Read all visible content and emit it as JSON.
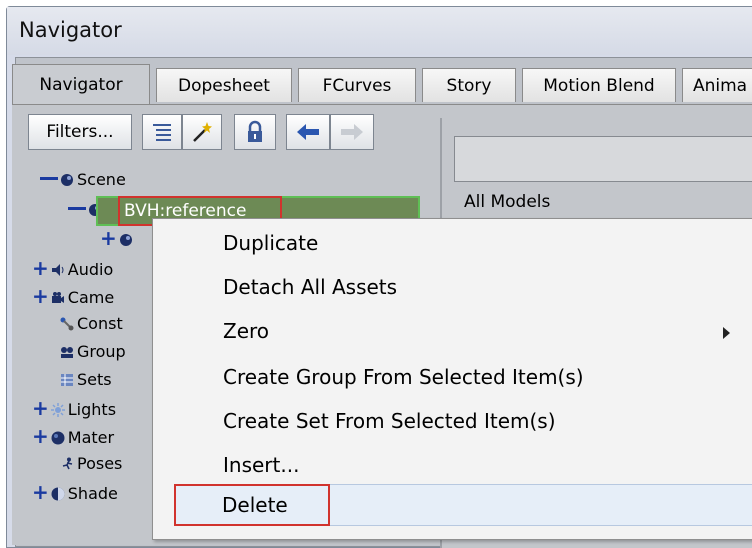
{
  "window": {
    "title": "Navigator"
  },
  "tabs": [
    {
      "label": "Navigator"
    },
    {
      "label": "Dopesheet"
    },
    {
      "label": "FCurves"
    },
    {
      "label": "Story"
    },
    {
      "label": "Motion Blend"
    },
    {
      "label": "Anima"
    }
  ],
  "toolbar": {
    "filters_label": "Filters...",
    "icons": [
      "list-icon",
      "magic-wand-icon",
      "lock-icon",
      "arrow-left-icon",
      "arrow-right-icon"
    ]
  },
  "tree": {
    "items": [
      {
        "label": "Scene",
        "icon": "scene-icon"
      },
      {
        "label": "BVH:reference",
        "icon": "scene-icon"
      },
      {
        "label": "",
        "icon": "scene-icon"
      },
      {
        "label": "Audio",
        "icon": "audio-icon"
      },
      {
        "label": "Came",
        "icon": "camera-icon"
      },
      {
        "label": "Const",
        "icon": "constraint-icon"
      },
      {
        "label": "Group",
        "icon": "group-icon"
      },
      {
        "label": "Sets",
        "icon": "sets-icon"
      },
      {
        "label": "Lights",
        "icon": "light-icon"
      },
      {
        "label": "Mater",
        "icon": "material-icon"
      },
      {
        "label": "Poses",
        "icon": "pose-icon"
      },
      {
        "label": "Shade",
        "icon": "shader-icon"
      }
    ]
  },
  "right_pane": {
    "list_label": "All Models"
  },
  "context_menu": {
    "items": [
      {
        "label": "Duplicate"
      },
      {
        "label": "Detach All Assets"
      },
      {
        "label": "Zero",
        "has_submenu": true
      },
      {
        "label": "Create Group From Selected Item(s)"
      },
      {
        "label": "Create Set From Selected Item(s)"
      },
      {
        "label": "Insert..."
      },
      {
        "label": "Delete",
        "highlighted": true
      }
    ]
  },
  "colors": {
    "highlight_border": "#d1332d",
    "selection_green": "#5fbf55",
    "expand_blue": "#1a3aa0"
  }
}
